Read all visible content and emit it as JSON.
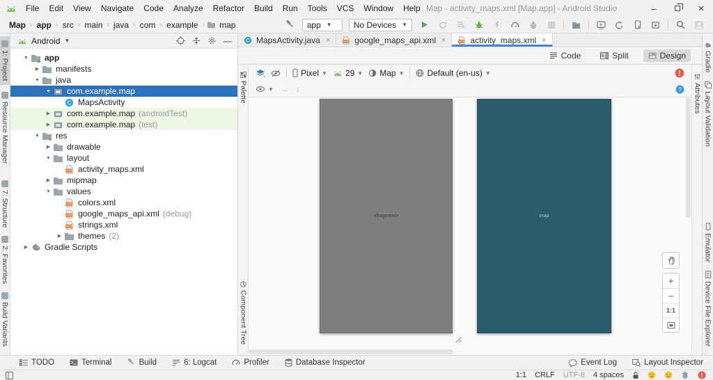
{
  "titlebar": {
    "title": "Map - activity_maps.xml [Map.app] - Android Studio",
    "menus": [
      "File",
      "Edit",
      "View",
      "Navigate",
      "Code",
      "Analyze",
      "Refactor",
      "Build",
      "Run",
      "Tools",
      "VCS",
      "Window",
      "Help"
    ]
  },
  "toolbar": {
    "breadcrumbs": [
      "Map",
      "app",
      "src",
      "main",
      "java",
      "com",
      "example",
      "map"
    ],
    "run_config": "app",
    "device": "No Devices"
  },
  "left_strip": [
    "1: Project",
    "Resource Manager",
    "7: Structure",
    "2: Favorites",
    "Build Variants"
  ],
  "right_strip": [
    "Gradle",
    "Layout Validation",
    "Emulator",
    "Device File Explorer"
  ],
  "project": {
    "mode": "Android",
    "tree": [
      {
        "label": "app"
      },
      {
        "label": "manifests"
      },
      {
        "label": "java"
      },
      {
        "label": "com.example.map"
      },
      {
        "label": "MapsActivity"
      },
      {
        "label": "com.example.map",
        "suffix": "(androidTest)"
      },
      {
        "label": "com.example.map",
        "suffix": "(test)"
      },
      {
        "label": "res"
      },
      {
        "label": "drawable"
      },
      {
        "label": "layout"
      },
      {
        "label": "activity_maps.xml"
      },
      {
        "label": "mipmap"
      },
      {
        "label": "values"
      },
      {
        "label": "colors.xml"
      },
      {
        "label": "google_maps_api.xml",
        "suffix": "(debug)"
      },
      {
        "label": "strings.xml"
      },
      {
        "label": "themes",
        "suffix": "(2)"
      },
      {
        "label": "Gradle Scripts"
      }
    ]
  },
  "tabs": [
    {
      "label": "MapsActivity.java"
    },
    {
      "label": "google_maps_api.xml"
    },
    {
      "label": "activity_maps.xml"
    }
  ],
  "modes": {
    "code": "Code",
    "split": "Split",
    "design": "Design"
  },
  "design": {
    "device": "Pixel",
    "api": "29",
    "theme": "Map",
    "locale": "Default (en-us)"
  },
  "rails": {
    "palette": "Palette",
    "component_tree": "Component Tree",
    "attributes": "Attributes"
  },
  "canvas": {
    "fragment_label": "<fragment>",
    "map_label": "map",
    "zoom": {
      "plus": "+",
      "minus": "−",
      "actual": "1:1"
    }
  },
  "bottom_bar": {
    "left": [
      "TODO",
      "Terminal",
      "Build",
      "6: Logcat",
      "Profiler",
      "Database Inspector"
    ],
    "right": [
      "Event Log",
      "Layout Inspector"
    ]
  },
  "status_bar": {
    "position": "1:1",
    "line_sep": "CRLF",
    "encoding": "UTF-8",
    "indent": "4 spaces"
  },
  "colors": {
    "selection_blue": "#2d72b8",
    "run_green": "#59a869",
    "android_green": "#78c257",
    "error_red": "#e4584f",
    "help_blue": "#389fd6",
    "xml_orange": "#e8853c",
    "phone_gray": "#7f7f7f",
    "map_teal": "#2c5d6d",
    "test_green_bg": "#eef6e4",
    "tab_accent": "#4a88c7"
  }
}
